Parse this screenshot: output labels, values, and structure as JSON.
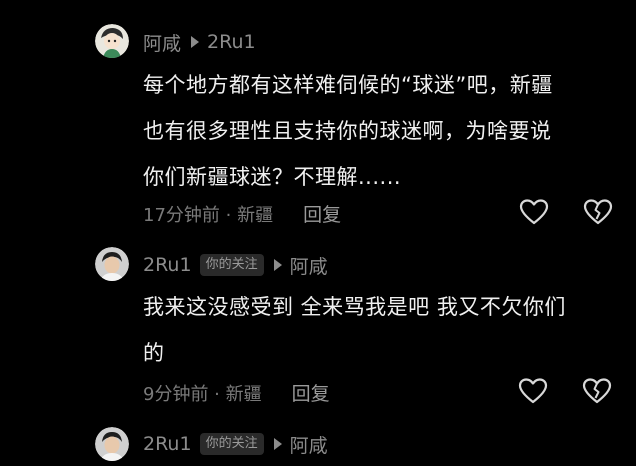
{
  "comments": [
    {
      "author": "阿咸",
      "reply_to": "2Ru1",
      "text_lines": [
        "每个地方都有这样难伺候的“球迷”吧，新疆",
        "也有很多理性且支持你的球迷啊，为啥要说",
        "你们新疆球迷？不理解......"
      ],
      "time_location": "17分钟前 · 新疆",
      "reply_label": "回复"
    },
    {
      "author": "2Ru1",
      "author_tag": "你的关注",
      "reply_to": "阿咸",
      "text_lines": [
        "我来这没感受到 全来骂我是吧 我又不欠你们",
        "的"
      ],
      "time_location": "9分钟前 · 新疆",
      "reply_label": "回复"
    },
    {
      "author": "2Ru1",
      "author_tag": "你的关注",
      "reply_to": "阿咸"
    }
  ],
  "icons": {
    "like": "heart-outline-icon",
    "dislike": "broken-heart-icon",
    "reply_arrow": "triangle-right-icon"
  },
  "colors": {
    "background": "#000000",
    "text_primary": "#f0f0f0",
    "text_secondary": "#8c8c8c",
    "tag_background": "#2a2a2a"
  }
}
